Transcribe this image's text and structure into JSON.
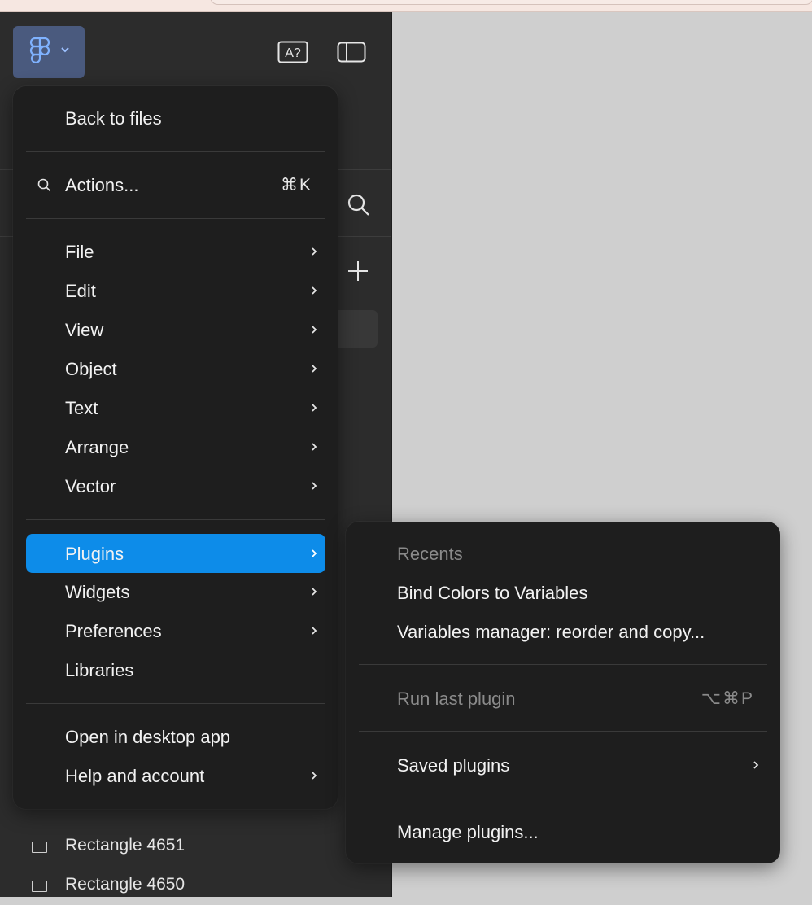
{
  "menu": {
    "back": "Back to files",
    "actions": {
      "label": "Actions...",
      "shortcut": "⌘K"
    },
    "file": "File",
    "edit": "Edit",
    "view": "View",
    "object": "Object",
    "text": "Text",
    "arrange": "Arrange",
    "vector": "Vector",
    "plugins": "Plugins",
    "widgets": "Widgets",
    "preferences": "Preferences",
    "libraries": "Libraries",
    "open_desktop": "Open in desktop app",
    "help": "Help and account"
  },
  "submenu": {
    "recents_heading": "Recents",
    "recent_1": "Bind Colors to Variables",
    "recent_2": "Variables manager: reorder and copy...",
    "run_last": {
      "label": "Run last plugin",
      "shortcut": "⌥⌘P"
    },
    "saved": "Saved plugins",
    "manage": "Manage plugins..."
  },
  "layers": {
    "row_1": "Rectangle 4651",
    "row_2": "Rectangle 4650"
  },
  "colors": {
    "accent": "#0d8ce9",
    "menu_bg": "#1e1e1e",
    "sidebar_bg": "#2c2c2c",
    "canvas_bg": "#cfcfcf"
  }
}
